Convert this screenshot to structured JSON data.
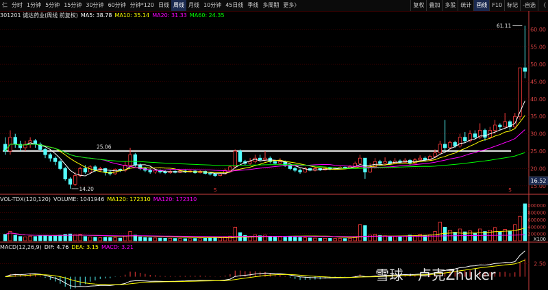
{
  "toolbar": {
    "left": [
      "仁",
      "分时",
      "1分钟",
      "5分钟",
      "15分钟",
      "30分钟",
      "60分钟",
      "分钟*120",
      "日线",
      "周线",
      "月线",
      "10分钟",
      "45日线",
      "季线",
      "多周期",
      "更多〉"
    ],
    "active_index": 9,
    "right": [
      "复权",
      "叠加",
      "多股",
      "统计",
      "画线",
      "F10",
      "标记",
      "-自选",
      "〈"
    ],
    "right_active_index": 4
  },
  "price_info": {
    "title": "301201 诚达药业(周线 前复权)",
    "ma5": "MA5: 38.78",
    "ma10": "MA10: 35.14",
    "ma20": "MA20: 31.33",
    "ma60": "MA60: 24.35"
  },
  "volume_info": {
    "title": "VOL-TDX(120,120)",
    "volume": "VOLUME: 1041946",
    "ma20": "MA120: 172310",
    "ma120": "MA120: 172310"
  },
  "macd_info": {
    "title": "MACD(12,26,9)",
    "dif": "DIF: 4.76",
    "dea": "DEA: 3.15",
    "macd": "MACD: 3.21"
  },
  "watermark": "雪球 · 卢克Zhuker",
  "colors": {
    "up": "#ff3c3c",
    "down": "#54fcfc",
    "ma5": "#ffffff",
    "ma10": "#ffff00",
    "ma20": "#ff00ff",
    "ma60": "#00ff00",
    "grid": "#5a0000",
    "axis": "#d04040"
  },
  "chart_data": {
    "type": "candlestick",
    "price_axis": {
      "ticks": [
        15,
        20,
        25,
        30,
        35,
        40,
        45,
        50,
        55,
        60
      ],
      "ylim": [
        13,
        63
      ]
    },
    "current_price_label": "16.52",
    "annotations": {
      "high": "61.11",
      "low": "14.20",
      "resistance_line": 25.06,
      "resistance_label": "25.06"
    },
    "markers": [
      "S",
      "S"
    ],
    "volume_axis": {
      "ticks": [
        200000,
        400000,
        600000,
        800000,
        1000000
      ],
      "tick_labels": [
        "200000",
        "400000",
        "600000",
        "800000",
        "1000000"
      ],
      "unit_label": "X100"
    },
    "macd_axis": {
      "ticks": [
        2.5
      ],
      "tick_labels": [
        "2.50"
      ]
    },
    "candles": [
      [
        27,
        25,
        29,
        24,
        180000
      ],
      [
        25,
        29,
        31,
        24,
        260000
      ],
      [
        29,
        27,
        30,
        26,
        160000
      ],
      [
        27,
        26,
        28,
        25,
        120000
      ],
      [
        26,
        27,
        28,
        25,
        110000
      ],
      [
        27,
        28,
        29,
        26,
        130000
      ],
      [
        28,
        27,
        28.5,
        26,
        120000
      ],
      [
        27,
        25.5,
        27.5,
        25,
        140000
      ],
      [
        25.5,
        24,
        26,
        23,
        150000
      ],
      [
        24,
        23,
        24.5,
        22,
        130000
      ],
      [
        23,
        22,
        23.5,
        21,
        140000
      ],
      [
        22,
        20,
        22.5,
        19.5,
        160000
      ],
      [
        20,
        17,
        20.5,
        16.5,
        180000
      ],
      [
        17,
        15.5,
        17.5,
        14.2,
        190000
      ],
      [
        15.5,
        18,
        19,
        15,
        170000
      ],
      [
        18,
        20,
        20.5,
        17.5,
        180000
      ],
      [
        20,
        19,
        21,
        18.5,
        120000
      ],
      [
        19,
        20.5,
        21,
        18.5,
        110000
      ],
      [
        20.5,
        19.5,
        21,
        19,
        100000
      ],
      [
        19.5,
        20,
        20.5,
        19,
        90000
      ],
      [
        20,
        19,
        20.2,
        18,
        100000
      ],
      [
        19,
        18.5,
        19.5,
        18,
        90000
      ],
      [
        18.5,
        19.8,
        20,
        18.2,
        85000
      ],
      [
        19.8,
        19.5,
        20,
        19,
        75000
      ],
      [
        19.5,
        21,
        22,
        19,
        130000
      ],
      [
        21,
        24,
        26,
        20.5,
        260000
      ],
      [
        24,
        21,
        24.5,
        20.5,
        160000
      ],
      [
        21,
        20,
        21.5,
        19.5,
        110000
      ],
      [
        20,
        19.5,
        20.5,
        19,
        90000
      ],
      [
        19.5,
        19,
        20,
        18.5,
        85000
      ],
      [
        19,
        19.5,
        20,
        18.5,
        80000
      ],
      [
        19.5,
        19,
        19.8,
        18.6,
        75000
      ],
      [
        19,
        18.8,
        19.5,
        18.4,
        70000
      ],
      [
        18.8,
        19.2,
        19.6,
        18.5,
        70000
      ],
      [
        19.2,
        18.9,
        19.5,
        18.6,
        65000
      ],
      [
        18.9,
        19.3,
        19.7,
        18.7,
        65000
      ],
      [
        19.3,
        19,
        19.6,
        18.7,
        60000
      ],
      [
        19,
        19.3,
        19.6,
        18.8,
        60000
      ],
      [
        19.3,
        18.8,
        19.5,
        18.5,
        65000
      ],
      [
        18.8,
        19.2,
        19.5,
        18.6,
        60000
      ],
      [
        19.2,
        18.6,
        19.4,
        18.3,
        70000
      ],
      [
        18.6,
        18.4,
        18.9,
        18,
        75000
      ],
      [
        18.4,
        18,
        18.6,
        17.6,
        80000
      ],
      [
        18,
        18.5,
        19,
        17.8,
        85000
      ],
      [
        18.5,
        19.5,
        20,
        18.2,
        100000
      ],
      [
        19.5,
        20.5,
        21,
        19,
        130000
      ],
      [
        20.5,
        25,
        25.5,
        20,
        380000
      ],
      [
        25,
        22,
        25.5,
        21.5,
        230000
      ],
      [
        22,
        21.5,
        22.5,
        21,
        150000
      ],
      [
        21.5,
        22,
        23,
        21,
        130000
      ],
      [
        22,
        23,
        24,
        21.5,
        170000
      ],
      [
        23,
        22.5,
        24,
        22,
        140000
      ],
      [
        22.5,
        23,
        25,
        22,
        160000
      ],
      [
        23,
        22,
        23.5,
        21.5,
        120000
      ],
      [
        22,
        21.5,
        22.5,
        21,
        100000
      ],
      [
        21.5,
        22,
        23,
        21.2,
        110000
      ],
      [
        22,
        21,
        22.3,
        20.5,
        100000
      ],
      [
        21,
        20,
        21.5,
        19.5,
        110000
      ],
      [
        20,
        19.5,
        20.5,
        19,
        100000
      ],
      [
        19.5,
        19,
        20,
        18.5,
        95000
      ],
      [
        19,
        20,
        20.5,
        18.8,
        85000
      ],
      [
        20,
        19.5,
        20.3,
        19.2,
        80000
      ],
      [
        19.5,
        20,
        20.5,
        19.2,
        75000
      ],
      [
        20,
        19.6,
        20.3,
        19.3,
        70000
      ],
      [
        19.6,
        20.2,
        20.6,
        19.4,
        70000
      ],
      [
        20.2,
        19.8,
        20.5,
        19.5,
        68000
      ],
      [
        19.8,
        20.1,
        20.4,
        19.6,
        65000
      ],
      [
        20.1,
        20.4,
        20.7,
        19.9,
        65000
      ],
      [
        20.4,
        20.2,
        20.6,
        19.9,
        63000
      ],
      [
        20.2,
        20.6,
        21,
        20,
        70000
      ],
      [
        20.6,
        21.5,
        22,
        20.3,
        120000
      ],
      [
        21.5,
        23,
        24,
        21,
        450000
      ],
      [
        23,
        19,
        23,
        17,
        430000
      ],
      [
        19,
        20.5,
        21.5,
        18.8,
        160000
      ],
      [
        20.5,
        22,
        23,
        20,
        180000
      ],
      [
        22,
        21.5,
        22.5,
        20.8,
        150000
      ],
      [
        21.5,
        22,
        23.2,
        21,
        140000
      ],
      [
        22,
        21.5,
        22.4,
        21,
        120000
      ],
      [
        21.5,
        22.2,
        23,
        21.2,
        120000
      ],
      [
        22.2,
        21.8,
        22.6,
        21.4,
        110000
      ],
      [
        21.8,
        22.4,
        23,
        21.5,
        130000
      ],
      [
        22.4,
        21.5,
        22.8,
        21,
        160000
      ],
      [
        21.5,
        22.5,
        23,
        21.2,
        140000
      ],
      [
        22.5,
        23,
        23.8,
        22,
        180000
      ],
      [
        23,
        22.5,
        23.5,
        22,
        150000
      ],
      [
        22.5,
        23.5,
        24,
        22.3,
        170000
      ],
      [
        23.5,
        24.5,
        25.5,
        23,
        260000
      ],
      [
        24.5,
        27,
        28,
        24,
        520000
      ],
      [
        27,
        26,
        34,
        25,
        380000
      ],
      [
        26,
        27.5,
        28,
        25.5,
        300000
      ],
      [
        27.5,
        26.5,
        28,
        26,
        240000
      ],
      [
        26.5,
        29,
        30,
        26,
        330000
      ],
      [
        29,
        28,
        30.5,
        27.5,
        250000
      ],
      [
        28,
        30,
        31,
        27.5,
        280000
      ],
      [
        30,
        29,
        31,
        28.5,
        220000
      ],
      [
        29,
        31,
        33,
        28.5,
        330000
      ],
      [
        31,
        29,
        31.5,
        28,
        260000
      ],
      [
        29,
        31,
        32,
        28.5,
        300000
      ],
      [
        31,
        32.5,
        34,
        30,
        370000
      ],
      [
        32.5,
        32,
        33,
        31,
        250000
      ],
      [
        32,
        33.5,
        36,
        31.5,
        320000
      ],
      [
        33.5,
        32,
        34,
        31,
        280000
      ],
      [
        32,
        35,
        36,
        31.5,
        450000
      ],
      [
        35,
        49,
        49,
        34,
        690000
      ],
      [
        49,
        48,
        61.11,
        46,
        1041946
      ]
    ]
  }
}
